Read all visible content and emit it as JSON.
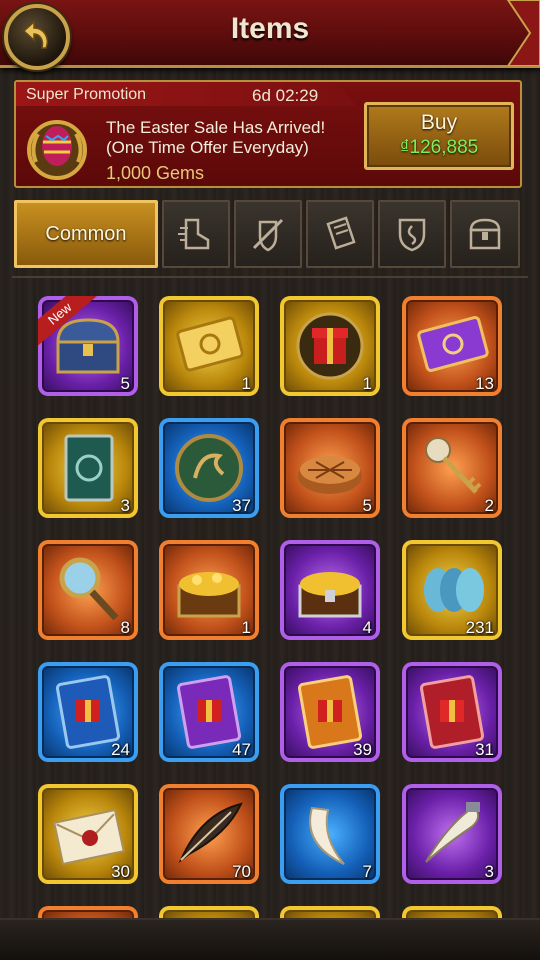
{
  "header": {
    "title": "Items"
  },
  "promo": {
    "label": "Super Promotion",
    "timer": "6d 02:29",
    "line1": "The Easter Sale Has Arrived!",
    "line2": "(One Time Offer Everyday)",
    "gems": "1,000 Gems",
    "buy_label": "Buy",
    "price": "₫126,885"
  },
  "tabs": [
    {
      "label": "Common",
      "icon": "common",
      "active": true
    },
    {
      "label": "",
      "icon": "speed-boot-icon",
      "active": false
    },
    {
      "label": "",
      "icon": "sword-shield-icon",
      "active": false
    },
    {
      "label": "",
      "icon": "book-icon",
      "active": false
    },
    {
      "label": "",
      "icon": "crest-icon",
      "active": false
    },
    {
      "label": "",
      "icon": "chest-icon",
      "active": false
    }
  ],
  "items": [
    {
      "icon": "chest-icon",
      "rarity": "purple",
      "count": "5",
      "badge": "New"
    },
    {
      "icon": "gold-ticket-icon",
      "rarity": "yellow",
      "count": "1"
    },
    {
      "icon": "gift-box-icon",
      "rarity": "yellow",
      "count": "1"
    },
    {
      "icon": "purple-ticket-icon",
      "rarity": "orange",
      "count": "13"
    },
    {
      "icon": "spellbook-icon",
      "rarity": "yellow",
      "count": "3"
    },
    {
      "icon": "dragon-token-icon",
      "rarity": "blue",
      "count": "37"
    },
    {
      "icon": "pie-icon",
      "rarity": "orange",
      "count": "5"
    },
    {
      "icon": "skull-key-icon",
      "rarity": "orange",
      "count": "2"
    },
    {
      "icon": "magnifier-icon",
      "rarity": "orange",
      "count": "8"
    },
    {
      "icon": "gold-chest-icon",
      "rarity": "orange",
      "count": "1"
    },
    {
      "icon": "silver-chest-icon",
      "rarity": "purple",
      "count": "4"
    },
    {
      "icon": "scales-icon",
      "rarity": "yellow",
      "count": "231"
    },
    {
      "icon": "gift-card-blue-icon",
      "rarity": "blue",
      "count": "24"
    },
    {
      "icon": "gift-card-purple-icon",
      "rarity": "blue",
      "count": "47"
    },
    {
      "icon": "gift-card-orange-icon",
      "rarity": "purple",
      "count": "39"
    },
    {
      "icon": "gift-card-red-icon",
      "rarity": "purple",
      "count": "31"
    },
    {
      "icon": "sealed-letter-icon",
      "rarity": "yellow",
      "count": "30"
    },
    {
      "icon": "feather-icon",
      "rarity": "orange",
      "count": "70"
    },
    {
      "icon": "fang-icon",
      "rarity": "blue",
      "count": "7"
    },
    {
      "icon": "horn-icon",
      "rarity": "purple",
      "count": "3"
    },
    {
      "icon": "partial-item-icon",
      "rarity": "orange",
      "count": ""
    },
    {
      "icon": "partial-item-icon",
      "rarity": "yellow",
      "count": ""
    },
    {
      "icon": "partial-item-icon",
      "rarity": "yellow",
      "count": ""
    },
    {
      "icon": "partial-item-icon",
      "rarity": "yellow",
      "count": ""
    }
  ]
}
